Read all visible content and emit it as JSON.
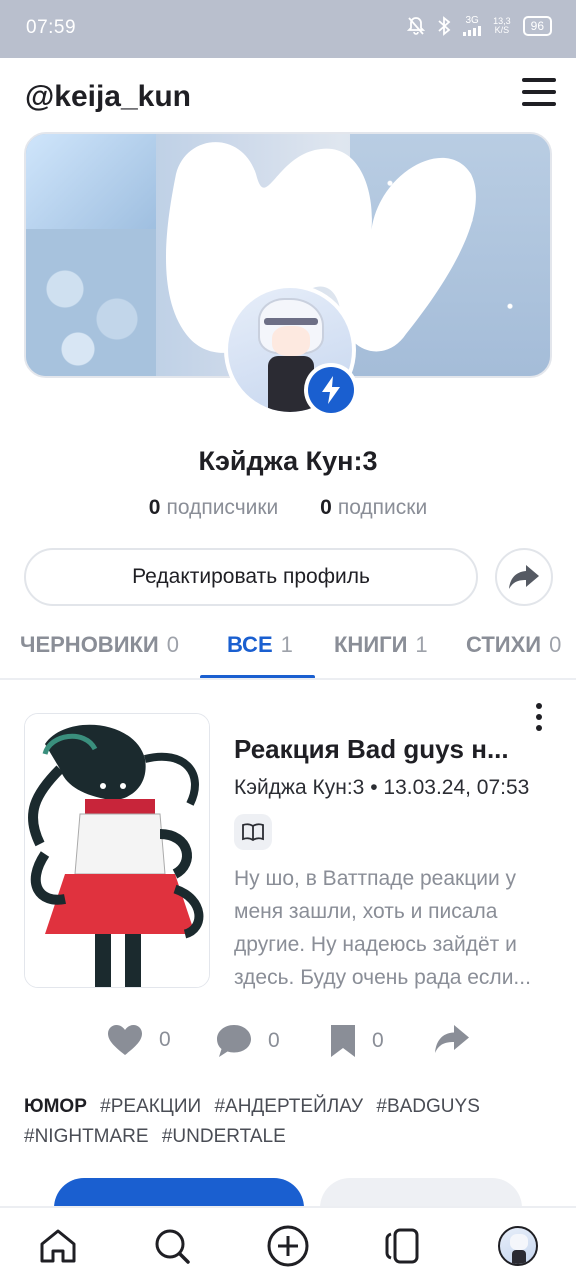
{
  "status_bar": {
    "time": "07:59",
    "network": "3G",
    "speed_value": "13,3",
    "speed_unit": "K/S",
    "battery": "96"
  },
  "header": {
    "username": "@keija_kun",
    "menu_icon": "hamburger-menu-icon"
  },
  "profile": {
    "display_name": "Кэйджа Кун:3",
    "followers_count": "0",
    "followers_label": "подписчики",
    "following_count": "0",
    "following_label": "подписки",
    "edit_button": "Редактировать профиль",
    "badge_icon": "lightning-bolt-icon",
    "share_icon": "share-arrow-icon"
  },
  "tabs": [
    {
      "label": "ЧЕРНОВИКИ",
      "count": "0",
      "active": false
    },
    {
      "label": "ВСЕ",
      "count": "1",
      "active": true
    },
    {
      "label": "КНИГИ",
      "count": "1",
      "active": false
    },
    {
      "label": "СТИХИ",
      "count": "0",
      "active": false
    }
  ],
  "post": {
    "title": "Реакция Bad guys н...",
    "author": "Кэйджа Кун:3",
    "separator": "•",
    "datetime": "13.03.24, 07:53",
    "type_icon": "open-book-icon",
    "excerpt": "Ну шо, в Ваттпаде реакции у меня зашли, хоть и писала другие. Ну надеюсь зайдёт и здесь. Буду очень рада если...",
    "likes": "0",
    "comments": "0",
    "bookmarks": "0",
    "genre": "ЮМОР",
    "tags": [
      "#РЕАКЦИИ",
      "#АНДЕРТЕЙЛАУ",
      "#BADGUYS",
      "#NIGHTMARE",
      "#UNDERTALE"
    ]
  },
  "colors": {
    "accent": "#1a5fd0",
    "text_primary": "#1f1f24",
    "text_secondary": "#8a8e97",
    "status_bar_bg": "#b9bfcd"
  },
  "bottom_nav": [
    "home-icon",
    "search-icon",
    "add-circle-icon",
    "library-icon",
    "profile-avatar"
  ]
}
